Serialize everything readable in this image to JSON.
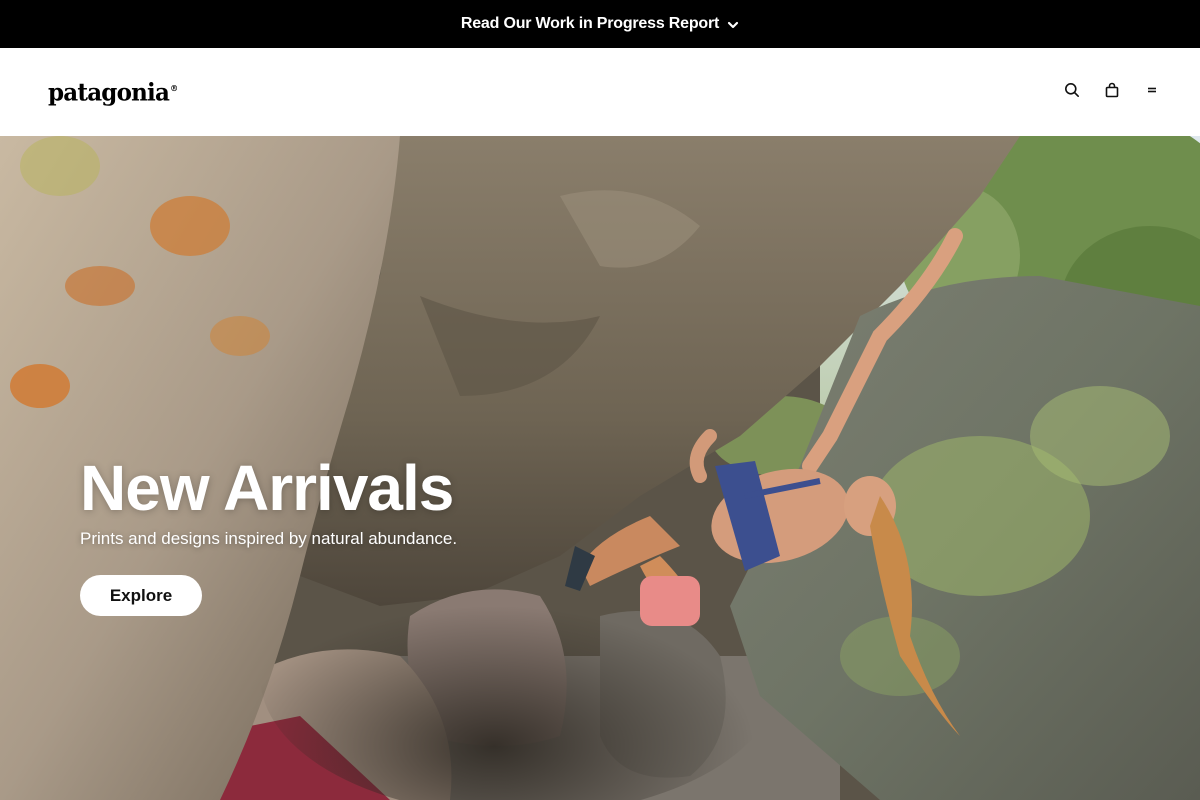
{
  "promo": {
    "text": "Read Our Work in Progress Report",
    "icon": "chevron-down-icon"
  },
  "header": {
    "logo": "patagonia",
    "actions": [
      {
        "name": "search",
        "icon": "search-icon"
      },
      {
        "name": "bag",
        "icon": "shopping-bag-icon"
      },
      {
        "name": "menu",
        "icon": "menu-icon"
      }
    ]
  },
  "hero": {
    "title": "New Arrivals",
    "subtitle": "Prints and designs inspired by natural abundance.",
    "cta_label": "Explore",
    "image_alt": "Climber bouldering under an overhanging rock"
  },
  "colors": {
    "promo_bg": "#000000",
    "header_bg": "#ffffff",
    "text_on_hero": "#ffffff",
    "cta_bg": "#ffffff"
  }
}
